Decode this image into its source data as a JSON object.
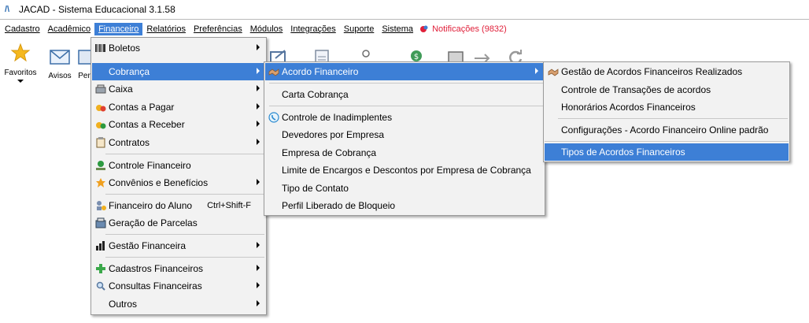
{
  "window": {
    "title": "JACAD - Sistema Educacional 3.1.58"
  },
  "menubar": {
    "items": [
      "Cadastro",
      "Acadêmico",
      "Financeiro",
      "Relatórios",
      "Preferências",
      "Módulos",
      "Integrações",
      "Suporte",
      "Sistema"
    ],
    "notifications": "Notificações (9832)"
  },
  "toolbar": {
    "favoritos": "Favoritos",
    "avisos": "Avisos",
    "partial": "Per"
  },
  "financeiro_menu": {
    "boletos": "Boletos",
    "cobranca": "Cobrança",
    "caixa": "Caixa",
    "contas_pagar": "Contas a Pagar",
    "contas_receber": "Contas a Receber",
    "contratos": "Contratos",
    "controle_financeiro": "Controle Financeiro",
    "convenios": "Convênios e Benefícios",
    "financeiro_aluno": "Financeiro do Aluno",
    "financeiro_aluno_shortcut": "Ctrl+Shift-F",
    "geracao_parcelas": "Geração de Parcelas",
    "gestao_financeira": "Gestão Financeira",
    "cadastros_financeiros": "Cadastros Financeiros",
    "consultas_financeiras": "Consultas Financeiras",
    "outros": "Outros"
  },
  "cobranca_menu": {
    "acordo_financeiro": "Acordo Financeiro",
    "carta_cobranca": "Carta Cobrança",
    "controle_inadimplentes": "Controle de Inadimplentes",
    "devedores_empresa": "Devedores por Empresa",
    "empresa_cobranca": "Empresa de Cobrança",
    "limite_encargos": "Limite de Encargos e Descontos por Empresa de Cobrança",
    "tipo_contato": "Tipo de Contato",
    "perfil_bloqueio": "Perfil Liberado de Bloqueio"
  },
  "acordo_menu": {
    "gestao_acordos": "Gestão de Acordos Financeiros Realizados",
    "controle_transacoes": "Controle de Transações de acordos",
    "honorarios": "Honorários Acordos Financeiros",
    "configuracoes": "Configurações - Acordo Financeiro Online padrão",
    "tipos_acordos": "Tipos de Acordos Financeiros"
  },
  "colors": {
    "highlight": "#3d7fd6",
    "notification": "#e0203a"
  }
}
